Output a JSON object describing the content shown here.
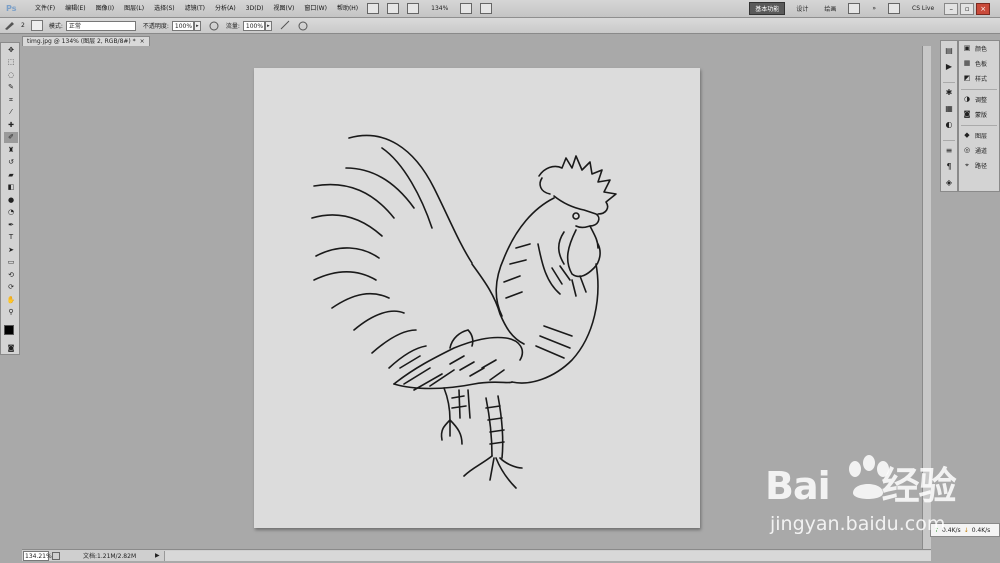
{
  "app": {
    "logo": "Ps"
  },
  "menu": {
    "items": [
      "文件(F)",
      "编辑(E)",
      "图像(I)",
      "图层(L)",
      "选择(S)",
      "滤镜(T)",
      "分析(A)",
      "3D(D)",
      "视图(V)",
      "窗口(W)",
      "帮助(H)"
    ],
    "zoom": "134%",
    "workspaces": [
      "基本功能",
      "设计",
      "绘画"
    ],
    "more": "»",
    "cs_live": "CS Live"
  },
  "options": {
    "brush_size": "2",
    "mode_label": "模式:",
    "mode_value": "正常",
    "opacity_label": "不透明度:",
    "opacity_value": "100%",
    "flow_label": "流量:",
    "flow_value": "100%"
  },
  "document": {
    "tab_title": "timg.jpg @ 134% (图层 2, RGB/8#) *",
    "close": "×"
  },
  "status": {
    "zoom": "134.21%",
    "doc_size": "文档:1.21M/2.82M",
    "arrow": "▶"
  },
  "panels": {
    "group1": [
      "颜色",
      "色板",
      "样式"
    ],
    "group2": [
      "调整",
      "蒙版"
    ],
    "group3": [
      "图层",
      "通道",
      "路径"
    ]
  },
  "network": {
    "up": "0.4K/s",
    "down": "0.4K/s"
  },
  "watermark": {
    "logo": "Bai",
    "logo2": "经验",
    "url": "jingyan.baidu.com"
  }
}
